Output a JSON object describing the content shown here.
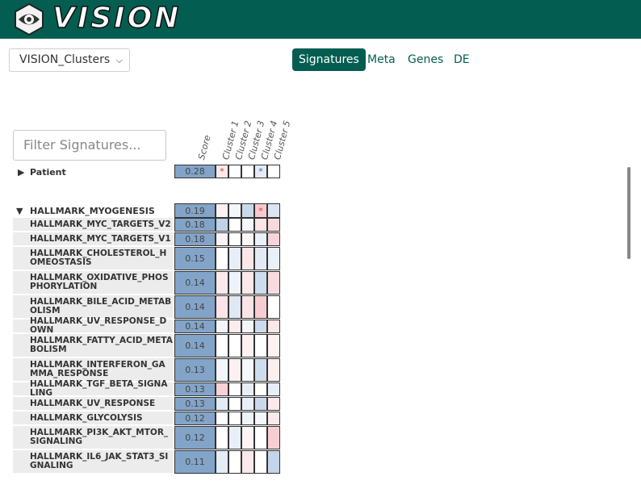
{
  "app": {
    "title": "VISION"
  },
  "cluster_select": {
    "value": "VISION_Clusters"
  },
  "tabs": [
    {
      "label": "Signatures",
      "active": true
    },
    {
      "label": "Meta",
      "active": false
    },
    {
      "label": "Genes",
      "active": false
    },
    {
      "label": "DE",
      "active": false
    }
  ],
  "filter": {
    "placeholder": "Filter Signatures..."
  },
  "columns": {
    "score": "Score",
    "clusters": [
      "Cluster 1",
      "Cluster 2",
      "Cluster 3",
      "Cluster 4",
      "Cluster 5"
    ]
  },
  "groups": [
    {
      "name": "Patient",
      "expanded": false,
      "score": "0.28",
      "cells": [
        {
          "color": "#fde9ea",
          "mark": "*"
        },
        {
          "color": "#ffffff",
          "mark": ""
        },
        {
          "color": "#ffffff",
          "mark": ""
        },
        {
          "color": "#e4ecf6",
          "mark": "*"
        },
        {
          "color": "#ffffff",
          "mark": ""
        }
      ]
    },
    {
      "name": "HALLMARK_MYOGENESIS",
      "expanded": true,
      "score": "0.19",
      "cells": [
        {
          "color": "#fbf1f2",
          "mark": ""
        },
        {
          "color": "#f3f6fb",
          "mark": ""
        },
        {
          "color": "#c9d9eb",
          "mark": ""
        },
        {
          "color": "#f8c8cc",
          "mark": "*"
        },
        {
          "color": "#dbe5f2",
          "mark": ""
        }
      ],
      "rows": [
        {
          "label": "HALLMARK_MYC_TARGETS_V2",
          "score": "0.18",
          "cells": [
            "#bfd2e8",
            "#ffffff",
            "#f4f7fc",
            "#fde4e6",
            "#f9d9dc"
          ]
        },
        {
          "label": "HALLMARK_MYC_TARGETS_V1",
          "score": "0.18",
          "cells": [
            "#fdf3f4",
            "#ffffff",
            "#fdf5f6",
            "#e9f0f8",
            "#f8d4d8"
          ]
        },
        {
          "label": "HALLMARK_CHOLESTEROL_HOMEOSTASIS",
          "score": "0.15",
          "cells": [
            "#ffffff",
            "#e7eef7",
            "#fbe6e8",
            "#e2eaf5",
            "#eaf0f8"
          ]
        },
        {
          "label": "HALLMARK_OXIDATIVE_PHOSPHORYLATION",
          "score": "0.14",
          "cells": [
            "#fbe8ea",
            "#eef3f9",
            "#fbe8ea",
            "#cddcee",
            "#f9dade"
          ]
        },
        {
          "label": "HALLMARK_BILE_ACID_METABOLISM",
          "score": "0.14",
          "cells": [
            "#fbe4e7",
            "#dfe8f4",
            "#fbe4e7",
            "#f6cdd1",
            "#ffffff"
          ]
        },
        {
          "label": "HALLMARK_UV_RESPONSE_DOWN",
          "score": "0.14",
          "cells": [
            "#f1f5fb",
            "#fcecee",
            "#f3f6fb",
            "#ccdaed",
            "#fbe6e8"
          ]
        },
        {
          "label": "HALLMARK_FATTY_ACID_METABOLISM",
          "score": "0.14",
          "cells": [
            "#ffffff",
            "#ffffff",
            "#fdf0f1",
            "#ffffff",
            "#fdf1f2"
          ]
        },
        {
          "label": "HALLMARK_INTERFERON_GAMMA_RESPONSE",
          "score": "0.13",
          "cells": [
            "#f2f6fb",
            "#fdf0f1",
            "#f5f8fc",
            "#cfdcee",
            "#fdeff0"
          ]
        },
        {
          "label": "HALLMARK_TGF_BETA_SIGNALING",
          "score": "0.13",
          "cells": [
            "#f8d2d6",
            "#ffffff",
            "#e6edf6",
            "#ffffff",
            "#e7eef7"
          ]
        },
        {
          "label": "HALLMARK_UV_RESPONSE",
          "score": "0.13",
          "cells": [
            "#e3ebf5",
            "#ffffff",
            "#e9eff8",
            "#c9d8ec",
            "#fce9eb"
          ]
        },
        {
          "label": "HALLMARK_GLYCOLYSIS",
          "score": "0.12",
          "cells": [
            "#ffffff",
            "#ffffff",
            "#eef3f9",
            "#f4f7fc",
            "#fbe9eb"
          ]
        },
        {
          "label": "HALLMARK_PI3K_AKT_MTOR_SIGNALING",
          "score": "0.12",
          "cells": [
            "#ffffff",
            "#e9eff8",
            "#fdf3f4",
            "#ffffff",
            "#f7cfd3"
          ]
        },
        {
          "label": "HALLMARK_IL6_JAK_STAT3_SIGNALING",
          "score": "0.11",
          "cells": [
            "#e4ecf6",
            "#ffffff",
            "#fbe8ea",
            "#ffffff",
            "#c4d4ea"
          ]
        }
      ]
    }
  ],
  "colors": {
    "header": "#035e51",
    "score_fill": "#82a4c8"
  }
}
